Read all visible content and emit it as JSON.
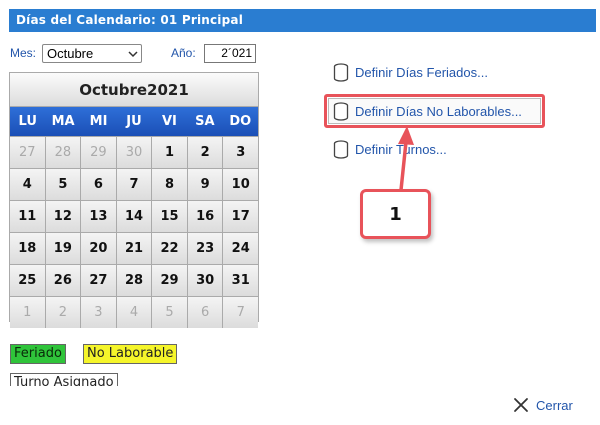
{
  "title": "Días del Calendario: 01 Principal",
  "filters": {
    "month_label": "Mes:",
    "month_value": "Octubre",
    "year_label": "Año:",
    "year_value": "2´021"
  },
  "calendar": {
    "header_month": "Octubre",
    "header_year": "2021",
    "weekdays": [
      "LU",
      "MA",
      "MI",
      "JU",
      "VI",
      "SA",
      "DO"
    ],
    "days": [
      {
        "d": "27",
        "other": true
      },
      {
        "d": "28",
        "other": true
      },
      {
        "d": "29",
        "other": true
      },
      {
        "d": "30",
        "other": true
      },
      {
        "d": "1"
      },
      {
        "d": "2"
      },
      {
        "d": "3"
      },
      {
        "d": "4"
      },
      {
        "d": "5"
      },
      {
        "d": "6"
      },
      {
        "d": "7"
      },
      {
        "d": "8"
      },
      {
        "d": "9"
      },
      {
        "d": "10"
      },
      {
        "d": "11"
      },
      {
        "d": "12"
      },
      {
        "d": "13"
      },
      {
        "d": "14"
      },
      {
        "d": "15"
      },
      {
        "d": "16"
      },
      {
        "d": "17"
      },
      {
        "d": "18"
      },
      {
        "d": "19"
      },
      {
        "d": "20"
      },
      {
        "d": "21"
      },
      {
        "d": "22"
      },
      {
        "d": "23"
      },
      {
        "d": "24"
      },
      {
        "d": "25"
      },
      {
        "d": "26"
      },
      {
        "d": "27"
      },
      {
        "d": "28"
      },
      {
        "d": "29"
      },
      {
        "d": "30"
      },
      {
        "d": "31"
      },
      {
        "d": "1",
        "other": true
      },
      {
        "d": "2",
        "other": true
      },
      {
        "d": "3",
        "other": true
      },
      {
        "d": "4",
        "other": true
      },
      {
        "d": "5",
        "other": true
      },
      {
        "d": "6",
        "other": true
      },
      {
        "d": "7",
        "other": true
      }
    ]
  },
  "legend": {
    "feriado": "Feriado",
    "no_laborable": "No Laborable",
    "turno_asignado": "Turno Asignado"
  },
  "links": {
    "feriados": "Definir Días Feriados...",
    "no_laborables": "Definir Días No Laborables...",
    "turnos": "Definir Turnos..."
  },
  "callout_number": "1",
  "footer": {
    "close_label": "Cerrar"
  },
  "colors": {
    "title_bar": "#2a7dd1",
    "weekday_header": "#1f5cc4",
    "feriado": "#2fc43a",
    "no_laborable": "#f5f52a",
    "highlight": "#e8535a",
    "link": "#2255aa"
  },
  "icons": {
    "link_icon": "database-icon",
    "close_icon": "close-icon",
    "select_icon": "chevron-down-icon"
  }
}
